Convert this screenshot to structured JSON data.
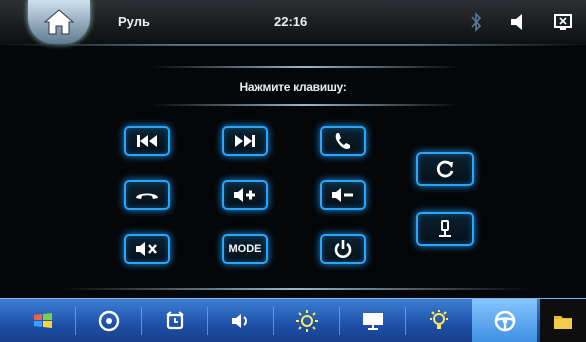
{
  "header": {
    "title": "Руль",
    "clock": "22:16",
    "icons": [
      "home-icon",
      "bluetooth-icon",
      "volume-icon",
      "close-window-icon"
    ]
  },
  "main": {
    "prompt": "Нажмите клавишу:",
    "keys": [
      {
        "name": "prev-track",
        "icon": "prev-track-icon"
      },
      {
        "name": "next-track",
        "icon": "next-track-icon"
      },
      {
        "name": "phone-answer",
        "icon": "phone-answer-icon"
      },
      {
        "name": "phone-hangup",
        "icon": "phone-hangup-icon"
      },
      {
        "name": "volume-up",
        "icon": "volume-up-icon"
      },
      {
        "name": "volume-down",
        "icon": "volume-down-icon"
      },
      {
        "name": "mute",
        "icon": "mute-icon"
      },
      {
        "name": "mode",
        "label": "MODE"
      },
      {
        "name": "power",
        "icon": "power-icon"
      },
      {
        "name": "reset",
        "icon": "refresh-icon"
      },
      {
        "name": "confirm",
        "icon": "pin-icon"
      }
    ]
  },
  "bottom_nav": {
    "items": [
      "windows-icon",
      "disc-icon",
      "alarm-clock-icon",
      "speaker-icon",
      "brightness-icon",
      "monitor-icon",
      "bulb-icon",
      "steering-wheel-icon",
      "folder-icon"
    ],
    "active": "steering-wheel-icon"
  },
  "colors": {
    "accent": "#2aa6ff",
    "nav_bar": "#1e4fa6",
    "nav_active": "#86c6ff"
  }
}
